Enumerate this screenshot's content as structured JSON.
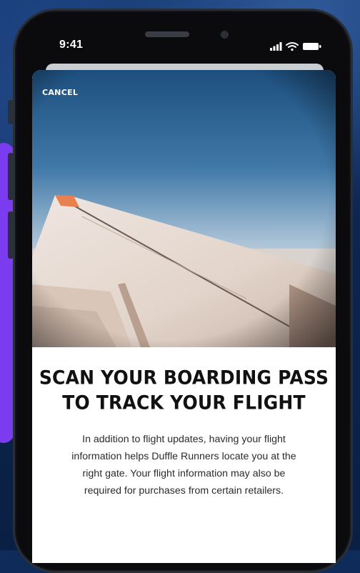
{
  "status_bar": {
    "time": "9:41",
    "icons": [
      "signal-icon",
      "wifi-icon",
      "battery-icon"
    ]
  },
  "sheet": {
    "cancel_label": "CANCEL",
    "title_line1": "SCAN YOUR BOARDING PASS",
    "title_line2": "TO TRACK YOUR FLIGHT",
    "body_line1": "In addition to flight updates, having your flight",
    "body_line2": "information helps Duffle Runners locate you at the",
    "body_line3": "right gate. Your flight information may also be",
    "body_line4": "required for purchases from certain retailers."
  },
  "colors": {
    "background": "#0f2b5a",
    "accent_purple": "#7b3cf0",
    "wingtip": "#e7814f",
    "sky_top": "#1d4f7e",
    "sky_bottom": "#e6e8ea"
  }
}
